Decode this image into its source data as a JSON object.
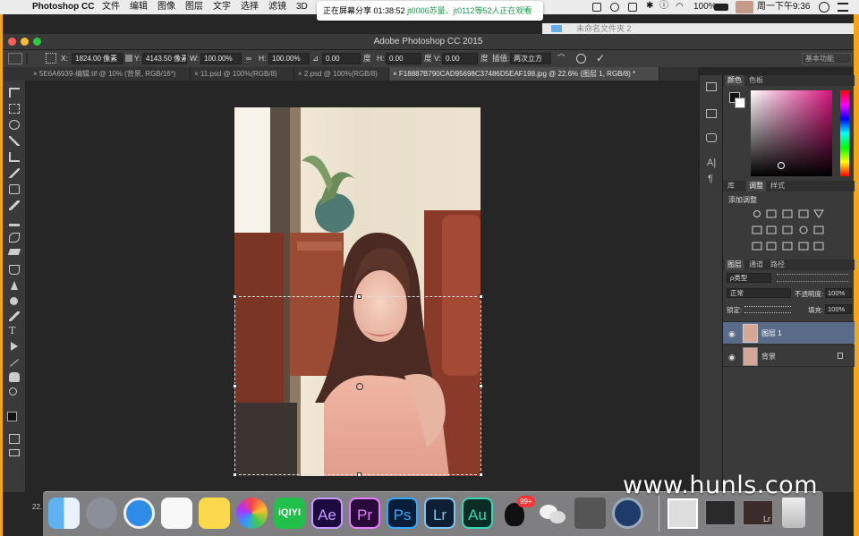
{
  "menubar": {
    "app_name": "Photoshop CC",
    "items": [
      "文件",
      "编辑",
      "图像",
      "图层",
      "文字",
      "选择",
      "滤镜",
      "3D"
    ],
    "battery": "100%",
    "datetime": "周一下午9:36"
  },
  "share_banner": {
    "prefix": "正在屏幕分享 01:38:52",
    "viewers": "jt0006苏量、jt0112等52人正在观看"
  },
  "finder_peek": {
    "folder": "未命名文件夹 2"
  },
  "window": {
    "title": "Adobe Photoshop CC 2015"
  },
  "options": {
    "x_label": "X:",
    "x_value": "1824.00 像素",
    "y_label": "Y:",
    "y_value": "4143.50 像素",
    "w_label": "W:",
    "w_value": "100.00%",
    "h_label": "H:",
    "h_value": "100.00%",
    "rotate_value": "0.00",
    "rotate_unit": "度",
    "hskew_label": "H:",
    "hskew_value": "0.00",
    "hskew_unit": "度",
    "vskew_label": "V:",
    "vskew_value": "0.00",
    "vskew_unit": "度",
    "interp_label": "插值:",
    "interp_value": "两次立方",
    "workspace": "基本功能"
  },
  "tabs": [
    {
      "label": "5E6A6939-编辑.tif @ 10% (背景, RGB/16*)"
    },
    {
      "label": "11.psd @ 100%(RGB/8)"
    },
    {
      "label": "2.psd @ 100%(RGB/8)"
    },
    {
      "label": "F18887B790CAD95698C37486D5EAF198.jpg @ 22.6% (图层 1, RGB/8) *"
    }
  ],
  "status": {
    "zoom": "22."
  },
  "color_panel": {
    "tab1": "颜色",
    "tab2": "色板"
  },
  "adjust_panel": {
    "tab1": "库",
    "tab2": "调整",
    "tab3": "样式",
    "heading": "添加调整"
  },
  "layers_panel": {
    "tab1": "图层",
    "tab2": "通道",
    "tab3": "路径",
    "kind": "ρ类型",
    "blend_mode": "正常",
    "opacity_label": "不透明度:",
    "opacity_value": "100%",
    "lock_label": "锁定:",
    "fill_label": "填充:",
    "fill_value": "100%",
    "layers": [
      {
        "name": "图层 1",
        "selected": true
      },
      {
        "name": "背景",
        "selected": false
      }
    ]
  },
  "dock": {
    "apps": [
      "Finder",
      "Launchpad",
      "Safari",
      "Reminders",
      "Notes",
      "Photos",
      "iQIYI",
      "Ae",
      "Pr",
      "Ps",
      "Lr",
      "Au",
      "QQ",
      "WeChat",
      "Screenshot",
      "QuickTime",
      "Trash"
    ],
    "qq_badge": "99+",
    "lr_mini": "Lr"
  },
  "watermark": "www.hunls.com",
  "colors": {
    "accent_orange": "#f3a51c",
    "share_green": "#1aa04a",
    "selected_layer": "#5a6b8a"
  }
}
